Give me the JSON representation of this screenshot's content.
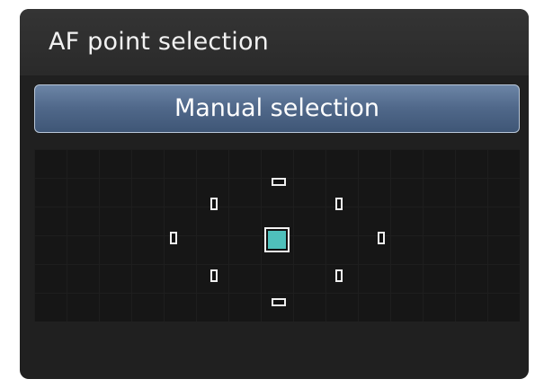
{
  "menu": {
    "title": "AF point selection",
    "mode_label": "Manual selection"
  },
  "af_points": {
    "selected": "center"
  },
  "colors": {
    "background": "#202020",
    "header": "#2e2e2e",
    "button": "#56708f",
    "selected_point": "#4fc0bb",
    "point_outline": "#f0f0f0"
  }
}
